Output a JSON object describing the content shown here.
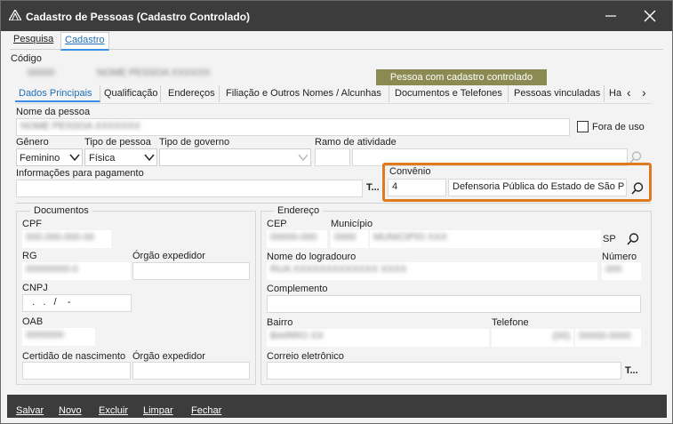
{
  "window": {
    "title": "Cadastro de Pessoas (Cadastro Controlado)",
    "app_icon": "app-logo-icon",
    "minimize_icon": "minimize-icon",
    "close_icon": "close-icon"
  },
  "top_tabs": [
    {
      "label": "Pesquisa",
      "active": false
    },
    {
      "label": "Cadastro",
      "active": true
    }
  ],
  "codigo": {
    "label": "Código",
    "value_blurred_1": "00000",
    "value_blurred_2": "NOME PESSOA XXXXXX"
  },
  "controlled_badge": "Pessoa com cadastro controlado",
  "sub_tabs": [
    {
      "label": "Dados Principais",
      "active": true
    },
    {
      "label": "Qualificação",
      "active": false
    },
    {
      "label": "Endereços",
      "active": false
    },
    {
      "label": "Filiação e Outros Nomes / Alcunhas",
      "active": false
    },
    {
      "label": "Documentos e Telefones",
      "active": false
    },
    {
      "label": "Pessoas vinculadas",
      "active": false
    },
    {
      "label": "Ha",
      "active": false
    }
  ],
  "sub_tab_nav": {
    "prev": "‹",
    "next": "›"
  },
  "nome_pessoa": {
    "label": "Nome da pessoa",
    "value_blurred": "NOME PESSOA XXXXXXX"
  },
  "fora_de_uso": {
    "label": "Fora de uso",
    "checked": false
  },
  "genero": {
    "label": "Gênero",
    "value": "Feminino"
  },
  "tipo_pessoa": {
    "label": "Tipo de pessoa",
    "value": "Física"
  },
  "tipo_governo": {
    "label": "Tipo de governo",
    "value": ""
  },
  "ramo_atividade": {
    "label": "Ramo de atividade",
    "value": ""
  },
  "informacoes_pagamento": {
    "label": "Informações para pagamento",
    "value": "",
    "ellipsis": "T..."
  },
  "convenio": {
    "label": "Convênio",
    "code": "4",
    "name": "Defensoria Pública do Estado de São P"
  },
  "documentos": {
    "title": "Documentos",
    "cpf": {
      "label": "CPF",
      "value_blurred": "000.000.000-00"
    },
    "rg": {
      "label": "RG",
      "value_blurred": "00000000-0"
    },
    "orgao_expedidor_rg": {
      "label": "Órgão expedidor",
      "value": ""
    },
    "cnpj": {
      "label": "CNPJ",
      "value": "  .   .   /    -"
    },
    "oab": {
      "label": "OAB",
      "value_blurred": "0000000"
    },
    "certidao": {
      "label": "Certidão de nascimento",
      "value": ""
    },
    "orgao_expedidor_cert": {
      "label": "Órgão expedidor",
      "value": ""
    }
  },
  "endereco": {
    "title": "Endereço",
    "cep": {
      "label": "CEP",
      "value_blurred": "00000-000"
    },
    "municipio": {
      "label": "Município",
      "code_blurred": "0000",
      "name_blurred": "MUNICIPIO XXX",
      "uf": "SP"
    },
    "logradouro": {
      "label": "Nome do logradouro",
      "value_blurred": "RUA XXXXXXXXXXXXX XXXX"
    },
    "numero": {
      "label": "Número",
      "value_blurred": "000"
    },
    "complemento": {
      "label": "Complemento",
      "value": ""
    },
    "bairro": {
      "label": "Bairro",
      "value_blurred": "BAIRRO XX"
    },
    "telefone": {
      "label": "Telefone",
      "ddd_blurred": "(00)",
      "value_blurred": "00000-0000"
    },
    "correio": {
      "label": "Correio eletrônico",
      "value": "",
      "ellipsis": "T..."
    }
  },
  "footer": [
    {
      "label": "Salvar",
      "u": "S"
    },
    {
      "label": "Novo",
      "u": "N"
    },
    {
      "label": "Excluir",
      "u": "E"
    },
    {
      "label": "Limpar",
      "u": "L"
    },
    {
      "label": "Fechar",
      "u": "F"
    }
  ],
  "colors": {
    "titlebar": "#3c3c3c",
    "accent": "#3a8ee6",
    "highlight": "#e07a1f",
    "badge": "#8a8a52"
  }
}
